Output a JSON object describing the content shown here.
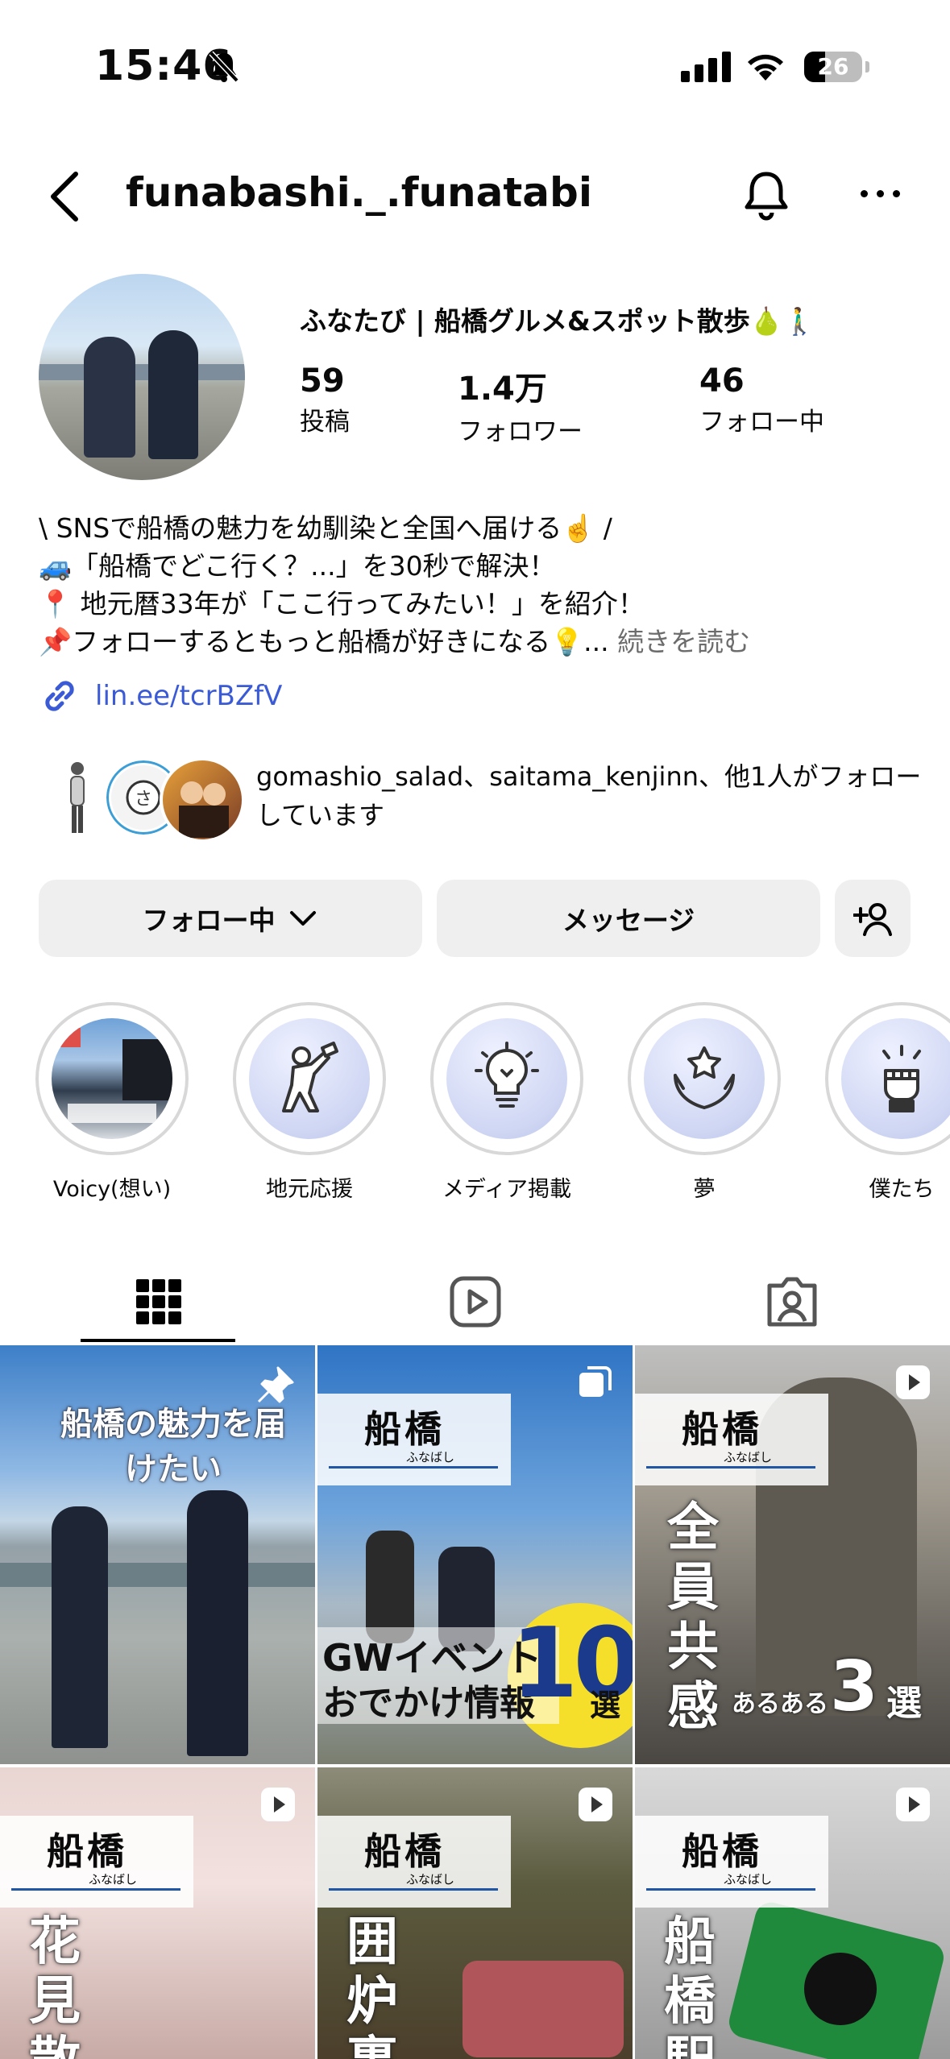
{
  "status_bar": {
    "time": "15:46",
    "battery": "26"
  },
  "header": {
    "username": "funabashi._.funatabi"
  },
  "profile": {
    "full_name": "ふなたび | 船橋グルメ&スポット散歩🍐🚶‍♂️",
    "stats": [
      {
        "value": "59",
        "label": "投稿"
      },
      {
        "value": "1.4万",
        "label": "フォロワー"
      },
      {
        "value": "46",
        "label": "フォロー中"
      }
    ],
    "bio_lines": [
      "\\ SNSで船橋の魅力を幼馴染と全国へ届ける☝️ /",
      "🚙「船橋でどこ行く？...」を30秒で解決！",
      "📍 地元暦33年が「ここ行ってみたい！」を紹介！",
      "📌フォローするともっと船橋が好きになる💡..."
    ],
    "bio_more": "続きを読む",
    "link": "lin.ee/tcrBZfV",
    "followed_by": "gomashio_salad、saitama_kenjinn、他1人がフォローしています"
  },
  "buttons": {
    "following": "フォロー中",
    "message": "メッセージ"
  },
  "highlights": [
    {
      "label": "Voicy(想い)"
    },
    {
      "label": "地元応援"
    },
    {
      "label": "メディア掲載"
    },
    {
      "label": "夢"
    },
    {
      "label": "僕たち"
    }
  ],
  "posts": [
    {
      "caption": "船橋の魅力を届けたい"
    },
    {
      "badge": "船橋",
      "badge_sub": "ふなばし",
      "caption_1": "GWイベント",
      "caption_2": "おでかけ情報",
      "number": "10",
      "suffix": "選"
    },
    {
      "badge": "船橋",
      "badge_sub": "ふなばし",
      "vertical": "全員共感",
      "small": "あるある",
      "number": "3",
      "suffix": "選"
    },
    {
      "badge": "船橋",
      "badge_sub": "ふなばし",
      "vertical": "花見散"
    },
    {
      "badge": "船橋",
      "badge_sub": "ふなばし",
      "vertical": "囲炉裏"
    },
    {
      "badge": "船橋",
      "badge_sub": "ふなばし",
      "vertical": "船橋駅"
    }
  ]
}
